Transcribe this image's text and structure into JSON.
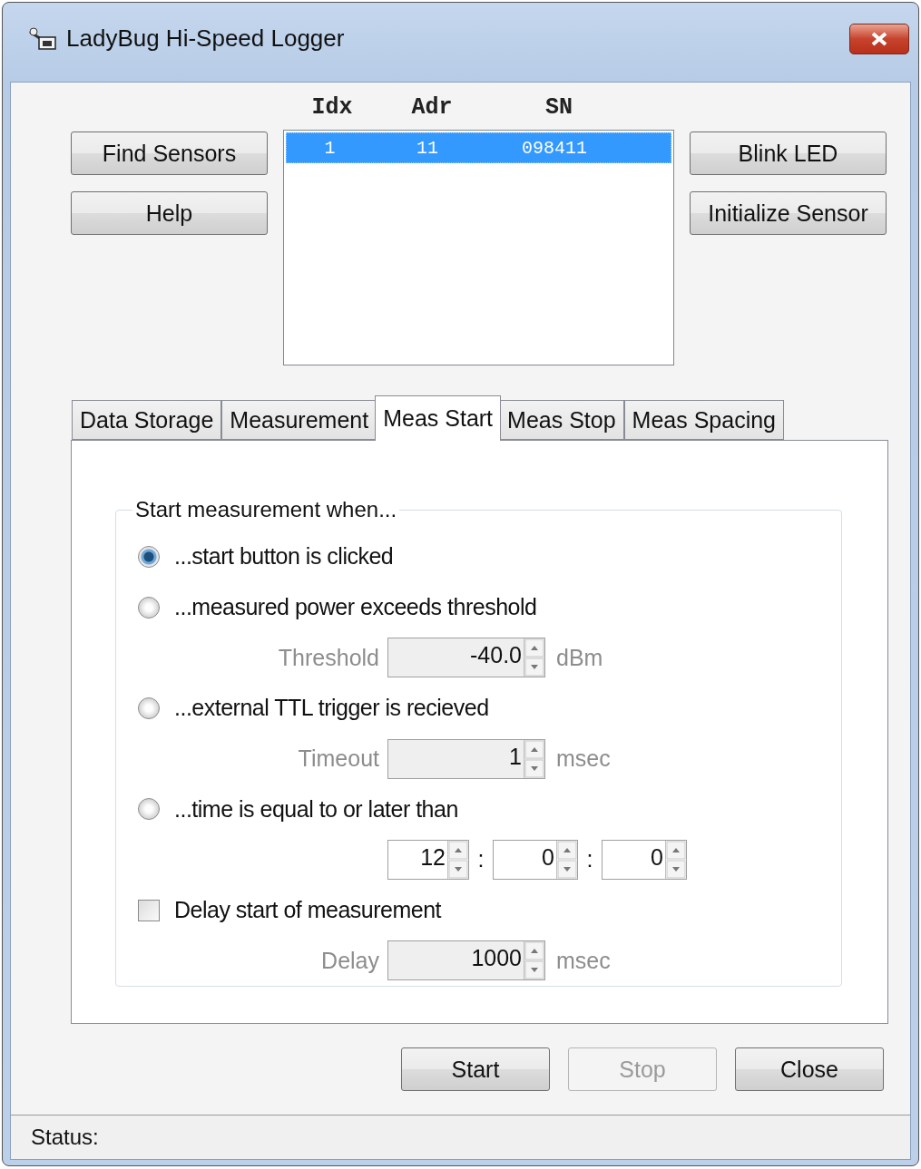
{
  "window": {
    "title": "LadyBug Hi-Speed Logger"
  },
  "left_buttons": [
    "Find Sensors",
    "Help"
  ],
  "sensor_list": {
    "columns": [
      "Idx",
      "Adr",
      "SN"
    ],
    "rows": [
      {
        "cells": [
          "1",
          "11",
          "098411"
        ],
        "selected": true
      }
    ]
  },
  "right_buttons": [
    "Blink LED",
    "Initialize Sensor"
  ],
  "tabs": [
    {
      "label": "Data Storage",
      "selected": false
    },
    {
      "label": "Measurement",
      "selected": false
    },
    {
      "label": "Meas Start",
      "selected": true
    },
    {
      "label": "Meas Stop",
      "selected": false
    },
    {
      "label": "Meas Spacing",
      "selected": false
    }
  ],
  "group": {
    "title": "Start measurement when...",
    "items": [
      {
        "kind": "radio",
        "label": "...start button is clicked",
        "selected": true
      },
      {
        "kind": "radio",
        "label": "...measured power exceeds threshold",
        "selected": false
      },
      {
        "kind": "param",
        "label": "Threshold",
        "value": "-40.0",
        "unit": "dBm",
        "disabled": true
      },
      {
        "kind": "radio",
        "label": "...external TTL trigger is recieved",
        "selected": false
      },
      {
        "kind": "param",
        "label": "Timeout",
        "value": "1",
        "unit": "msec",
        "disabled": true
      },
      {
        "kind": "radio",
        "label": "...time is equal to or later than",
        "selected": false
      },
      {
        "kind": "time",
        "fields": [
          "12",
          "0",
          "0"
        ],
        "separators": [
          ":",
          ":"
        ]
      },
      {
        "kind": "checkbox",
        "label": "Delay start of measurement",
        "checked": false
      },
      {
        "kind": "param",
        "label": "Delay",
        "value": "1000",
        "unit": "msec",
        "disabled": true
      }
    ]
  },
  "bottom_buttons": [
    {
      "label": "Start",
      "disabled": false
    },
    {
      "label": "Stop",
      "disabled": true
    },
    {
      "label": "Close",
      "disabled": false
    }
  ],
  "status_bar": {
    "label": "Status:"
  }
}
